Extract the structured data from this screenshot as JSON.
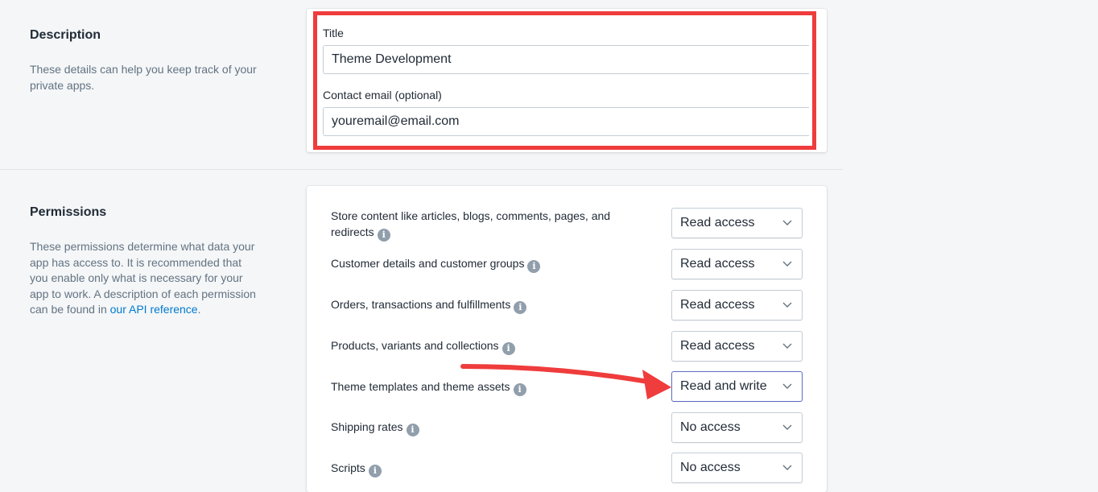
{
  "description_section": {
    "title": "Description",
    "help_text": "These details can help you keep track of your private apps."
  },
  "description_form": {
    "title_label": "Title",
    "title_value": "Theme Development",
    "email_label": "Contact email (optional)",
    "email_value": "youremail@email.com"
  },
  "permissions_section": {
    "title": "Permissions",
    "help_text_prefix": "These permissions determine what data your app has access to. It is recommended that you enable only what is necessary for your app to work. A description of each permission can be found in ",
    "help_link": "our API reference",
    "help_text_suffix": "."
  },
  "permissions": [
    {
      "label": "Store content like articles, blogs, comments, pages, and redirects",
      "access": "Read access"
    },
    {
      "label": "Customer details and customer groups",
      "access": "Read access"
    },
    {
      "label": "Orders, transactions and fulfillments",
      "access": "Read access"
    },
    {
      "label": "Products, variants and collections",
      "access": "Read access"
    },
    {
      "label": "Theme templates and theme assets",
      "access": "Read and write"
    },
    {
      "label": "Shipping rates",
      "access": "No access"
    },
    {
      "label": "Scripts",
      "access": "No access"
    }
  ],
  "icons": {
    "info": "info-icon",
    "chevron": "chevron-down-icon",
    "annotation_arrow": "annotation-arrow"
  },
  "colors": {
    "highlight": "#ef3c3c",
    "link": "#007ace",
    "background": "#f4f6f8",
    "focus": "#5c6ac4"
  }
}
